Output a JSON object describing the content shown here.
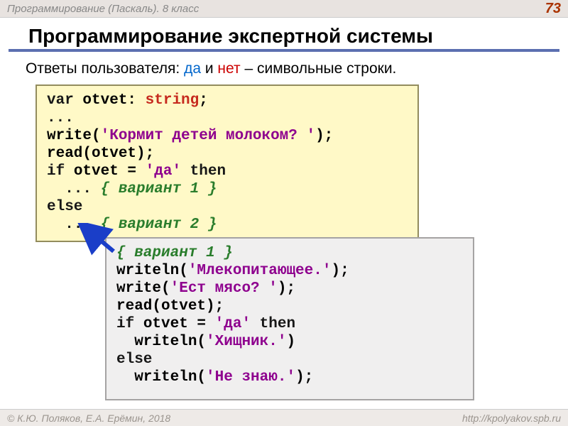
{
  "header": {
    "breadcrumb": "Программирование (Паскаль). 8 класс",
    "page_number": "73"
  },
  "title": "Программирование экспертной системы",
  "intro": {
    "prefix": "Ответы пользователя: ",
    "da": "да",
    "and": " и ",
    "net": "нет",
    "suffix": " – символьные строки."
  },
  "code1": {
    "l1_var": "var",
    "l1_id": " otvet: ",
    "l1_type": "string",
    "l1_end": ";",
    "l2": "...",
    "l3_a": "write(",
    "l3_s": "'Кормит детей молоком? '",
    "l3_b": ");",
    "l4": "read(otvet);",
    "l5_a": "if",
    "l5_b": " otvet = ",
    "l5_s": "'да'",
    "l5_c": " then",
    "l6_a": "  ... ",
    "l6_c": "{ вариант 1 }",
    "l7": "else",
    "l8_a": "  ... ",
    "l8_c": "{ вариант 2 }"
  },
  "code2": {
    "l1": "{ вариант 1 }",
    "l2_a": "writeln(",
    "l2_s": "'Млекопитающее.'",
    "l2_b": ");",
    "l3_a": "write(",
    "l3_s": "'Ест мясо? '",
    "l3_b": ");",
    "l4": "read(otvet);",
    "l5_a": "if",
    "l5_b": " otvet = ",
    "l5_s": "'да'",
    "l5_c": " then",
    "l6_a": "  writeln(",
    "l6_s": "'Хищник.'",
    "l6_b": ")",
    "l7": "else",
    "l8_a": "  writeln(",
    "l8_s": "'Не знаю.'",
    "l8_b": ");"
  },
  "footer": {
    "left": "© К.Ю. Поляков, Е.А. Ерёмин, 2018",
    "right": "http://kpolyakov.spb.ru"
  }
}
